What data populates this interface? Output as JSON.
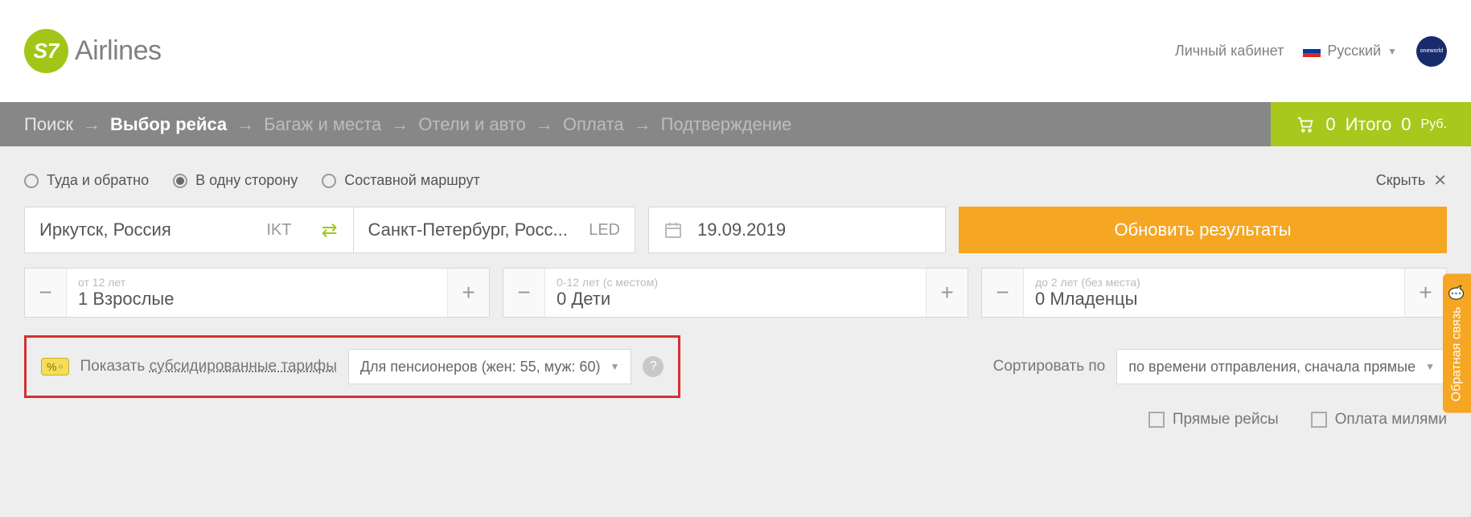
{
  "header": {
    "brand_prefix": "S7",
    "brand_text": "Airlines",
    "account_link": "Личный кабинет",
    "language_label": "Русский",
    "alliance": "oneworld"
  },
  "breadcrumb": {
    "items": [
      {
        "label": "Поиск",
        "state": "done"
      },
      {
        "label": "Выбор рейса",
        "state": "active"
      },
      {
        "label": "Багаж и места",
        "state": "future"
      },
      {
        "label": "Отели и авто",
        "state": "future"
      },
      {
        "label": "Оплата",
        "state": "future"
      },
      {
        "label": "Подтверждение",
        "state": "future"
      }
    ],
    "cart": {
      "count": "0",
      "label": "Итого",
      "amount": "0",
      "currency": "Руб."
    }
  },
  "trip_type": {
    "options": [
      {
        "label": "Туда и обратно",
        "selected": false
      },
      {
        "label": "В одну сторону",
        "selected": true
      },
      {
        "label": "Составной маршрут",
        "selected": false
      }
    ],
    "hide_label": "Скрыть"
  },
  "route": {
    "from_city": "Иркутск, Россия",
    "from_code": "IKT",
    "to_city": "Санкт-Петербург, Росс...",
    "to_code": "LED",
    "date": "19.09.2019",
    "update_label": "Обновить результаты"
  },
  "pax": {
    "adults": {
      "hint": "от 12 лет",
      "value": "1 Взрослые"
    },
    "children": {
      "hint": "0-12 лет (с местом)",
      "value": "0 Дети"
    },
    "infants": {
      "hint": "до 2 лет (без места)",
      "value": "0 Младенцы"
    }
  },
  "subsidy": {
    "show_prefix": "Показать ",
    "show_underlined": "субсидированные тарифы",
    "selected": "Для пенсионеров (жен: 55, муж: 60)"
  },
  "sort": {
    "label": "Сортировать по",
    "selected": "по времени отправления, сначала прямые"
  },
  "filters": {
    "direct": "Прямые рейсы",
    "miles": "Оплата милями"
  },
  "feedback": "Обратная связь"
}
